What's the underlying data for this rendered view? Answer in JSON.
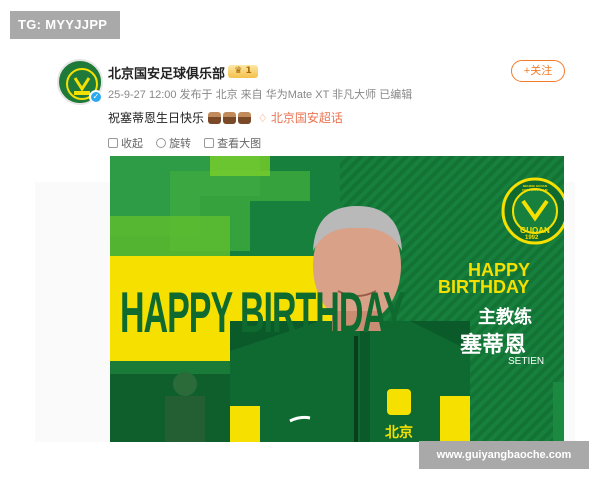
{
  "watermark_tg": "TG: MYYJJPP",
  "post": {
    "username": "北京国安足球俱乐部",
    "vip_level": "1",
    "meta": "25-9-27 12:00  发布于 北京  来自 华为Mate XT 非凡大师  已编辑",
    "follow_label": "+关注",
    "text": "祝塞蒂恩生日快乐",
    "topic": "北京国安超话",
    "toolbar": [
      {
        "label": "收起",
        "icon": "collapse-icon"
      },
      {
        "label": "旋转",
        "icon": "rotate-icon"
      },
      {
        "label": "查看大图",
        "icon": "zoom-icon"
      }
    ]
  },
  "banner": {
    "big_text": "HAPPY BIRTHDAY",
    "side_line1": "HAPPY",
    "side_line2": "BIRTHDAY",
    "role": "主教练",
    "name_cn": "塞蒂恩",
    "name_en": "SETIEN",
    "badge_top": "BEIJING GUOAN FOOTBALL CLUB",
    "badge_text": "GUOAN",
    "badge_year": "1992",
    "jersey_text": "北京"
  },
  "colors": {
    "accent_orange": "#f47b2a",
    "banner_green": "#157a3a",
    "birthday_yellow": "#f5e000"
  },
  "url_watermark": "www.guiyangbaoche.com"
}
